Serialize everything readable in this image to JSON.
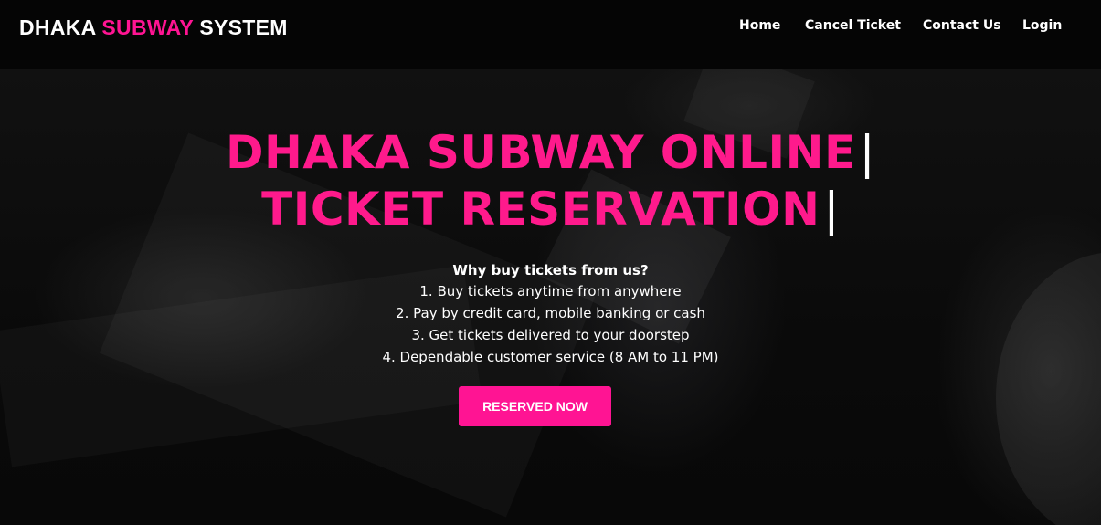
{
  "navbar": {
    "brand_part1": "DHAKA",
    "brand_part2": "SUBWAY",
    "brand_part3": "SYSTEM",
    "links": [
      {
        "label": "Home"
      },
      {
        "label": "Cancel Ticket"
      },
      {
        "label": "Contact Us"
      },
      {
        "label": "Login"
      }
    ]
  },
  "hero": {
    "headline_line1": "DHAKA SUBWAY ONLINE",
    "headline_line2": "TICKET RESERVATION",
    "cursor": "|",
    "why_title": "Why buy tickets from us?",
    "reasons": [
      "1. Buy tickets anytime from anywhere",
      "2. Pay by credit card, mobile banking or cash",
      "3. Get tickets delivered to your doorstep",
      "4. Dependable customer service (8 AM to 11 PM)"
    ],
    "cta_label": "RESERVED NOW"
  },
  "colors": {
    "accent": "#ff1493",
    "navbar_bg": "#050505",
    "text": "#ffffff"
  }
}
